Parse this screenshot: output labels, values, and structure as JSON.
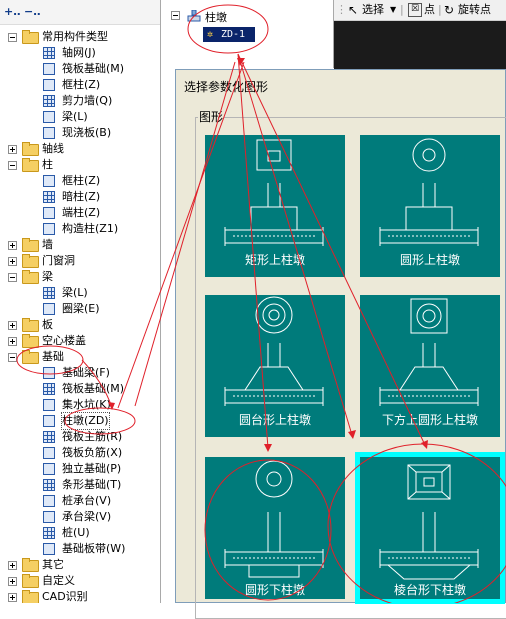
{
  "left_tree": {
    "items": [
      {
        "label": "常用构件类型",
        "level": 0,
        "kind": "folder",
        "expanded": true
      },
      {
        "label": "轴网(J)",
        "level": 1,
        "icon": "axis-grid-icon"
      },
      {
        "label": "筏板基础(M)",
        "level": 1,
        "icon": "raft-foundation-icon"
      },
      {
        "label": "框柱(Z)",
        "level": 1,
        "icon": "frame-column-icon"
      },
      {
        "label": "剪力墙(Q)",
        "level": 1,
        "icon": "shear-wall-icon"
      },
      {
        "label": "梁(L)",
        "level": 1,
        "icon": "beam-icon"
      },
      {
        "label": "现浇板(B)",
        "level": 1,
        "icon": "cast-slab-icon"
      },
      {
        "label": "轴线",
        "level": 0,
        "kind": "folder",
        "expanded": false
      },
      {
        "label": "柱",
        "level": 0,
        "kind": "folder",
        "expanded": true
      },
      {
        "label": "框柱(Z)",
        "level": 1,
        "icon": "frame-column-icon"
      },
      {
        "label": "暗柱(Z)",
        "level": 1,
        "icon": "hidden-column-icon"
      },
      {
        "label": "端柱(Z)",
        "level": 1,
        "icon": "end-column-icon"
      },
      {
        "label": "构造柱(Z1)",
        "level": 1,
        "icon": "structural-column-icon"
      },
      {
        "label": "墙",
        "level": 0,
        "kind": "folder",
        "expanded": false
      },
      {
        "label": "门窗洞",
        "level": 0,
        "kind": "folder",
        "expanded": false
      },
      {
        "label": "梁",
        "level": 0,
        "kind": "folder",
        "expanded": true
      },
      {
        "label": "梁(L)",
        "level": 1,
        "icon": "beam-icon"
      },
      {
        "label": "圈梁(E)",
        "level": 1,
        "icon": "ring-beam-icon"
      },
      {
        "label": "板",
        "level": 0,
        "kind": "folder",
        "expanded": false
      },
      {
        "label": "空心楼盖",
        "level": 0,
        "kind": "folder",
        "expanded": false
      },
      {
        "label": "基础",
        "level": 0,
        "kind": "folder",
        "expanded": true
      },
      {
        "label": "基础梁(F)",
        "level": 1,
        "icon": "foundation-beam-icon"
      },
      {
        "label": "筏板基础(M)",
        "level": 1,
        "icon": "raft-foundation-icon"
      },
      {
        "label": "集水坑(K)",
        "level": 1,
        "icon": "sump-pit-icon"
      },
      {
        "label": "柱墩(ZD)",
        "level": 1,
        "icon": "column-pier-icon",
        "selected": true
      },
      {
        "label": "筏板主筋(R)",
        "level": 1,
        "icon": "raft-main-rebar-icon"
      },
      {
        "label": "筏板负筋(X)",
        "level": 1,
        "icon": "raft-negative-rebar-icon"
      },
      {
        "label": "独立基础(P)",
        "level": 1,
        "icon": "isolated-footing-icon"
      },
      {
        "label": "条形基础(T)",
        "level": 1,
        "icon": "strip-footing-icon"
      },
      {
        "label": "桩承台(V)",
        "level": 1,
        "icon": "pile-cap-icon"
      },
      {
        "label": "承台梁(V)",
        "level": 1,
        "icon": "cap-beam-icon"
      },
      {
        "label": "桩(U)",
        "level": 1,
        "icon": "pile-icon"
      },
      {
        "label": "基础板带(W)",
        "level": 1,
        "icon": "foundation-strip-icon"
      },
      {
        "label": "其它",
        "level": 0,
        "kind": "folder",
        "expanded": false
      },
      {
        "label": "自定义",
        "level": 0,
        "kind": "folder",
        "expanded": false
      },
      {
        "label": "CAD识别",
        "level": 0,
        "kind": "folder",
        "expanded": false
      }
    ]
  },
  "component_tree": {
    "root_label": "柱墩",
    "child_label": "ZD-1"
  },
  "toolbar": {
    "select_label": "选择",
    "point_label": "点",
    "rotate_point_label": "旋转点"
  },
  "dialog": {
    "title": "选择参数化图形",
    "group_label": "图形",
    "shapes": [
      {
        "label": "矩形上柱墩",
        "shape": "rect-top"
      },
      {
        "label": "圆形上柱墩",
        "shape": "circle-top"
      },
      {
        "label": "圆台形上柱墩",
        "shape": "frustum-top"
      },
      {
        "label": "下方上圆形上柱墩",
        "shape": "square-round-top"
      },
      {
        "label": "圆形下柱墩",
        "shape": "circle-bottom"
      },
      {
        "label": "棱台形下柱墩",
        "shape": "prism-bottom",
        "selected": true
      }
    ]
  },
  "colors": {
    "tile_bg": "#007b7b",
    "tile_selected_border": "#00ffff",
    "annotation": "#e0202a",
    "selection_bg": "#0a246a",
    "folder": "#f5cf63"
  }
}
